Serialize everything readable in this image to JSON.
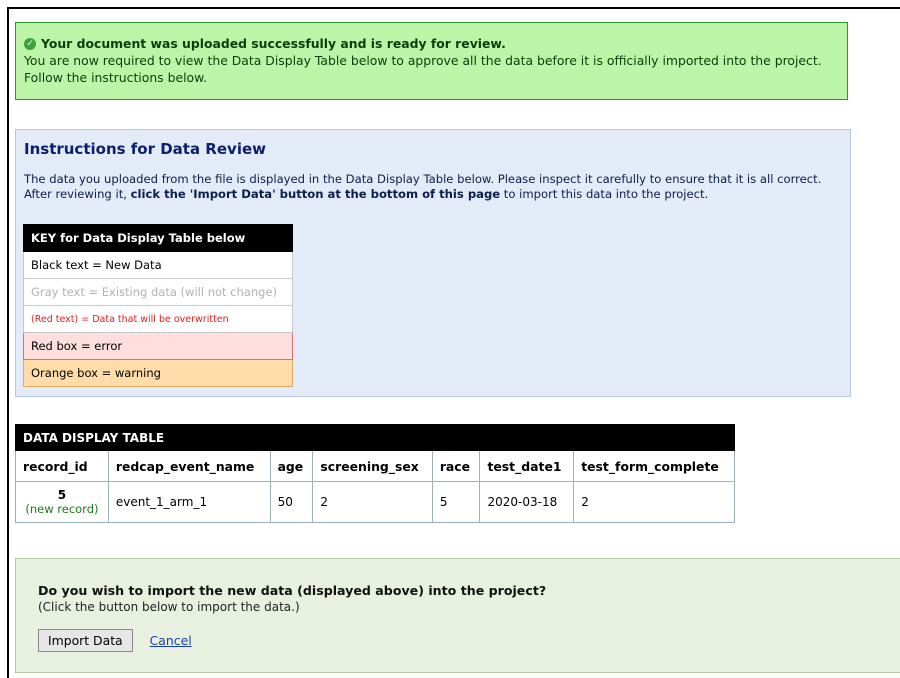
{
  "success": {
    "title": "Your document was uploaded successfully and is ready for review.",
    "line1": "You are now required to view the Data Display Table below to approve all the data before it is officially imported into the project.",
    "line2": "Follow the instructions below."
  },
  "instructions": {
    "title": "Instructions for Data Review",
    "text1": "The data you uploaded from the file is displayed in the Data Display Table below. Please inspect it carefully to ensure that it is all correct.",
    "text2_prefix": "After reviewing it, ",
    "text2_bold": "click the 'Import Data' button at the bottom of this page",
    "text2_suffix": " to import this data into the project."
  },
  "key": {
    "header": "KEY for Data Display Table below",
    "black": "Black text = New Data",
    "gray": "Gray text = Existing data (will not change)",
    "red": "(Red text) = Data that will be overwritten",
    "redbox": "Red box = error",
    "orangebox": "Orange box = warning"
  },
  "table": {
    "title": "DATA DISPLAY TABLE",
    "columns": [
      "record_id",
      "redcap_event_name",
      "age",
      "screening_sex",
      "race",
      "test_date1",
      "test_form_complete"
    ],
    "row": {
      "record_id": "5",
      "record_note": "(new record)",
      "redcap_event_name": "event_1_arm_1",
      "age": "50",
      "screening_sex": "2",
      "race": "5",
      "test_date1": "2020-03-18",
      "test_form_complete": "2"
    }
  },
  "import": {
    "question": "Do you wish to import the new data (displayed above) into the project?",
    "sub": "(Click the button below to import the data.)",
    "button": "Import Data",
    "cancel": "Cancel"
  }
}
